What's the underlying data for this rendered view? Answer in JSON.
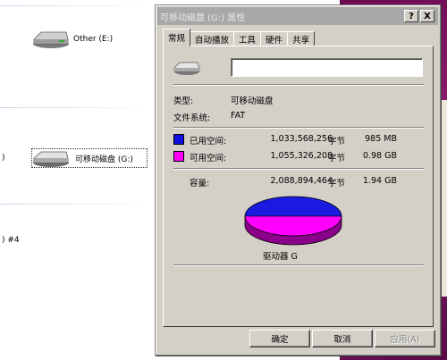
{
  "explorer": {
    "drives": [
      {
        "label": "Other (E:)"
      },
      {
        "label": "可移动磁盘 (G:)"
      }
    ],
    "edge_texts": [
      ")",
      ") #4"
    ]
  },
  "dialog": {
    "title": "可移动磁盘 (G:) 属性",
    "help_button": "?",
    "close_button": "X",
    "tabs": [
      "常规",
      "自动播放",
      "工具",
      "硬件",
      "共享"
    ],
    "active_tab": "常规",
    "name_value": "",
    "type_label": "类型:",
    "type_value": "可移动磁盘",
    "fs_label": "文件系统:",
    "fs_value": "FAT",
    "used": {
      "label": "已用空间:",
      "bytes": "1,033,568,256",
      "unit": "字节",
      "size": "985 MB",
      "color": "#1010e0"
    },
    "free": {
      "label": "可用空间:",
      "bytes": "1,055,326,208",
      "unit": "字节",
      "size": "0.98 GB",
      "color": "#ff00ff"
    },
    "capacity": {
      "label": "容量:",
      "bytes": "2,088,894,464",
      "unit": "字节",
      "size": "1.94 GB"
    },
    "drive_caption": "驱动器 G",
    "buttons": {
      "ok": "确定",
      "cancel": "取消",
      "apply": "应用(A)"
    }
  }
}
